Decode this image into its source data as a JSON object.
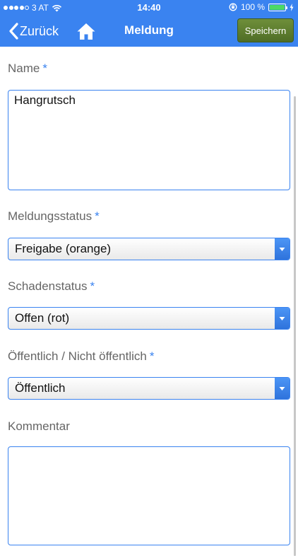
{
  "status_bar": {
    "carrier": "3 AT",
    "time": "14:40",
    "battery": "100 %"
  },
  "nav": {
    "back_label": "Zurück",
    "title": "Meldung",
    "save_label": "Speichern"
  },
  "form": {
    "name_label": "Name",
    "name_value": "Hangrutsch",
    "meldungsstatus_label": "Meldungsstatus",
    "meldungsstatus_value": "Freigabe (orange)",
    "schadenstatus_label": "Schadenstatus",
    "schadenstatus_value": "Offen (rot)",
    "oeffentlich_label": "Öffentlich / Nicht öffentlich",
    "oeffentlich_value": "Öffentlich",
    "kommentar_label": "Kommentar",
    "kommentar_value": "",
    "required_marker": "*"
  },
  "colors": {
    "accent": "#3a83f0",
    "save_button": "#5a7a2e",
    "battery_fill": "#4cd964"
  }
}
